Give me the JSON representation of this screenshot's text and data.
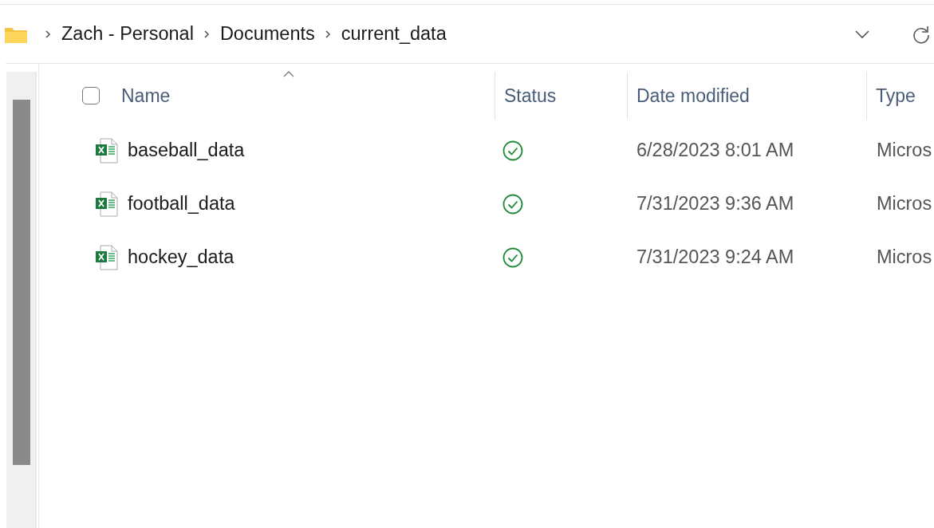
{
  "breadcrumb": [
    {
      "label": "Zach - Personal"
    },
    {
      "label": "Documents"
    },
    {
      "label": "current_data"
    }
  ],
  "table": {
    "select_all_checked": false,
    "columns": [
      {
        "label": "Name",
        "sorted": true
      },
      {
        "label": "Status",
        "sorted": false
      },
      {
        "label": "Date modified",
        "sorted": false
      },
      {
        "label": "Type",
        "sorted": false
      }
    ],
    "rows": [
      {
        "name": "baseball_data",
        "kind": "excel",
        "synced": true,
        "date": "6/28/2023 8:01 AM",
        "type": "Micros"
      },
      {
        "name": "football_data",
        "kind": "excel",
        "synced": true,
        "date": "7/31/2023 9:36 AM",
        "type": "Micros"
      },
      {
        "name": "hockey_data",
        "kind": "excel",
        "synced": true,
        "date": "7/31/2023 9:24 AM",
        "type": "Micros"
      }
    ]
  }
}
